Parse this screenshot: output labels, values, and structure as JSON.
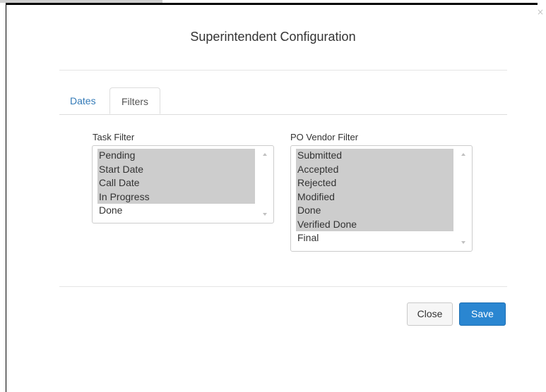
{
  "modal": {
    "title": "Superintendent Configuration",
    "close_glyph": "×"
  },
  "tabs": [
    {
      "label": "Dates",
      "active": false
    },
    {
      "label": "Filters",
      "active": true
    }
  ],
  "task_filter": {
    "label": "Task Filter",
    "options": [
      {
        "label": "Pending",
        "selected": true
      },
      {
        "label": "Start Date",
        "selected": true
      },
      {
        "label": "Call Date",
        "selected": true
      },
      {
        "label": "In Progress",
        "selected": true
      },
      {
        "label": "Done",
        "selected": false
      }
    ]
  },
  "po_vendor_filter": {
    "label": "PO Vendor Filter",
    "options": [
      {
        "label": "Submitted",
        "selected": true
      },
      {
        "label": "Accepted",
        "selected": true
      },
      {
        "label": "Rejected",
        "selected": true
      },
      {
        "label": "Modified",
        "selected": true
      },
      {
        "label": "Done",
        "selected": true
      },
      {
        "label": "Verified Done",
        "selected": true
      },
      {
        "label": "Final",
        "selected": false
      }
    ]
  },
  "footer": {
    "close_label": "Close",
    "save_label": "Save"
  },
  "colors": {
    "primary": "#2a86d1",
    "link": "#337ab7",
    "selected_option_bg": "#cdcdcd"
  }
}
